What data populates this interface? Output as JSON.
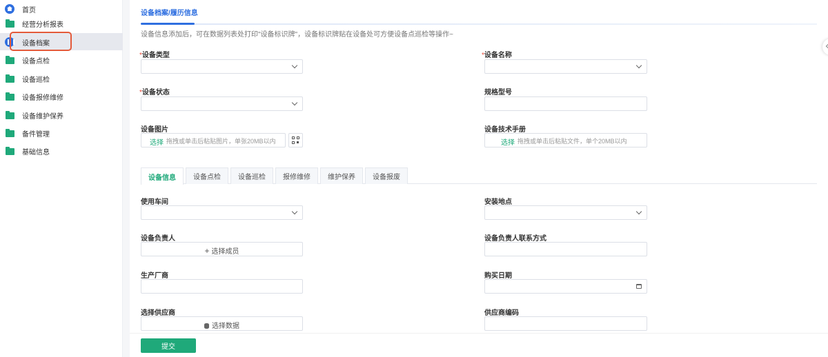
{
  "sidebar": {
    "items": [
      {
        "label": "首页",
        "icon": "home-icon"
      },
      {
        "label": "经营分析报表",
        "icon": "folder-icon"
      },
      {
        "label": "设备档案",
        "icon": "device-archive-icon"
      },
      {
        "label": "设备点检",
        "icon": "folder-icon"
      },
      {
        "label": "设备巡检",
        "icon": "folder-icon"
      },
      {
        "label": "设备报修维修",
        "icon": "folder-icon"
      },
      {
        "label": "设备维护保养",
        "icon": "folder-icon"
      },
      {
        "label": "备件管理",
        "icon": "folder-icon"
      },
      {
        "label": "基础信息",
        "icon": "folder-icon"
      }
    ],
    "active_index": 2
  },
  "page": {
    "tab_title": "设备档案/履历信息",
    "hint": "设备信息添加后，可在数据列表处打印\"设备标识牌\"，设备标识牌贴在设备处可方便设备点巡检等操作~"
  },
  "form": {
    "required_mark": "*",
    "device_type": {
      "label": "设备类型",
      "value": ""
    },
    "device_name": {
      "label": "设备名称",
      "value": ""
    },
    "device_status": {
      "label": "设备状态",
      "value": ""
    },
    "spec_model": {
      "label": "规格型号",
      "value": ""
    },
    "device_image": {
      "label": "设备图片",
      "choose": "选择",
      "hint": "拖拽或单击后粘贴图片，单张20MB以内"
    },
    "tech_manual": {
      "label": "设备技术手册",
      "choose": "选择",
      "hint": "拖拽或单击后粘贴文件，单个20MB以内"
    }
  },
  "tabs": [
    "设备信息",
    "设备点检",
    "设备巡检",
    "报修维修",
    "维护保养",
    "设备报废"
  ],
  "active_tab": 0,
  "detail": {
    "workshop": {
      "label": "使用车间",
      "value": ""
    },
    "location": {
      "label": "安装地点",
      "value": ""
    },
    "owner": {
      "label": "设备负责人",
      "button": "选择成员"
    },
    "owner_contact": {
      "label": "设备负责人联系方式",
      "value": ""
    },
    "manufacturer": {
      "label": "生产厂商",
      "value": ""
    },
    "purchase_date": {
      "label": "购买日期",
      "value": ""
    },
    "supplier": {
      "label": "选择供应商",
      "button": "选择数据"
    },
    "supplier_code": {
      "label": "供应商编码",
      "value": ""
    }
  },
  "actions": {
    "submit": "提交"
  },
  "colors": {
    "accent": "#1fa97a",
    "primary": "#2f6fe0",
    "highlight": "#e45a3a"
  }
}
